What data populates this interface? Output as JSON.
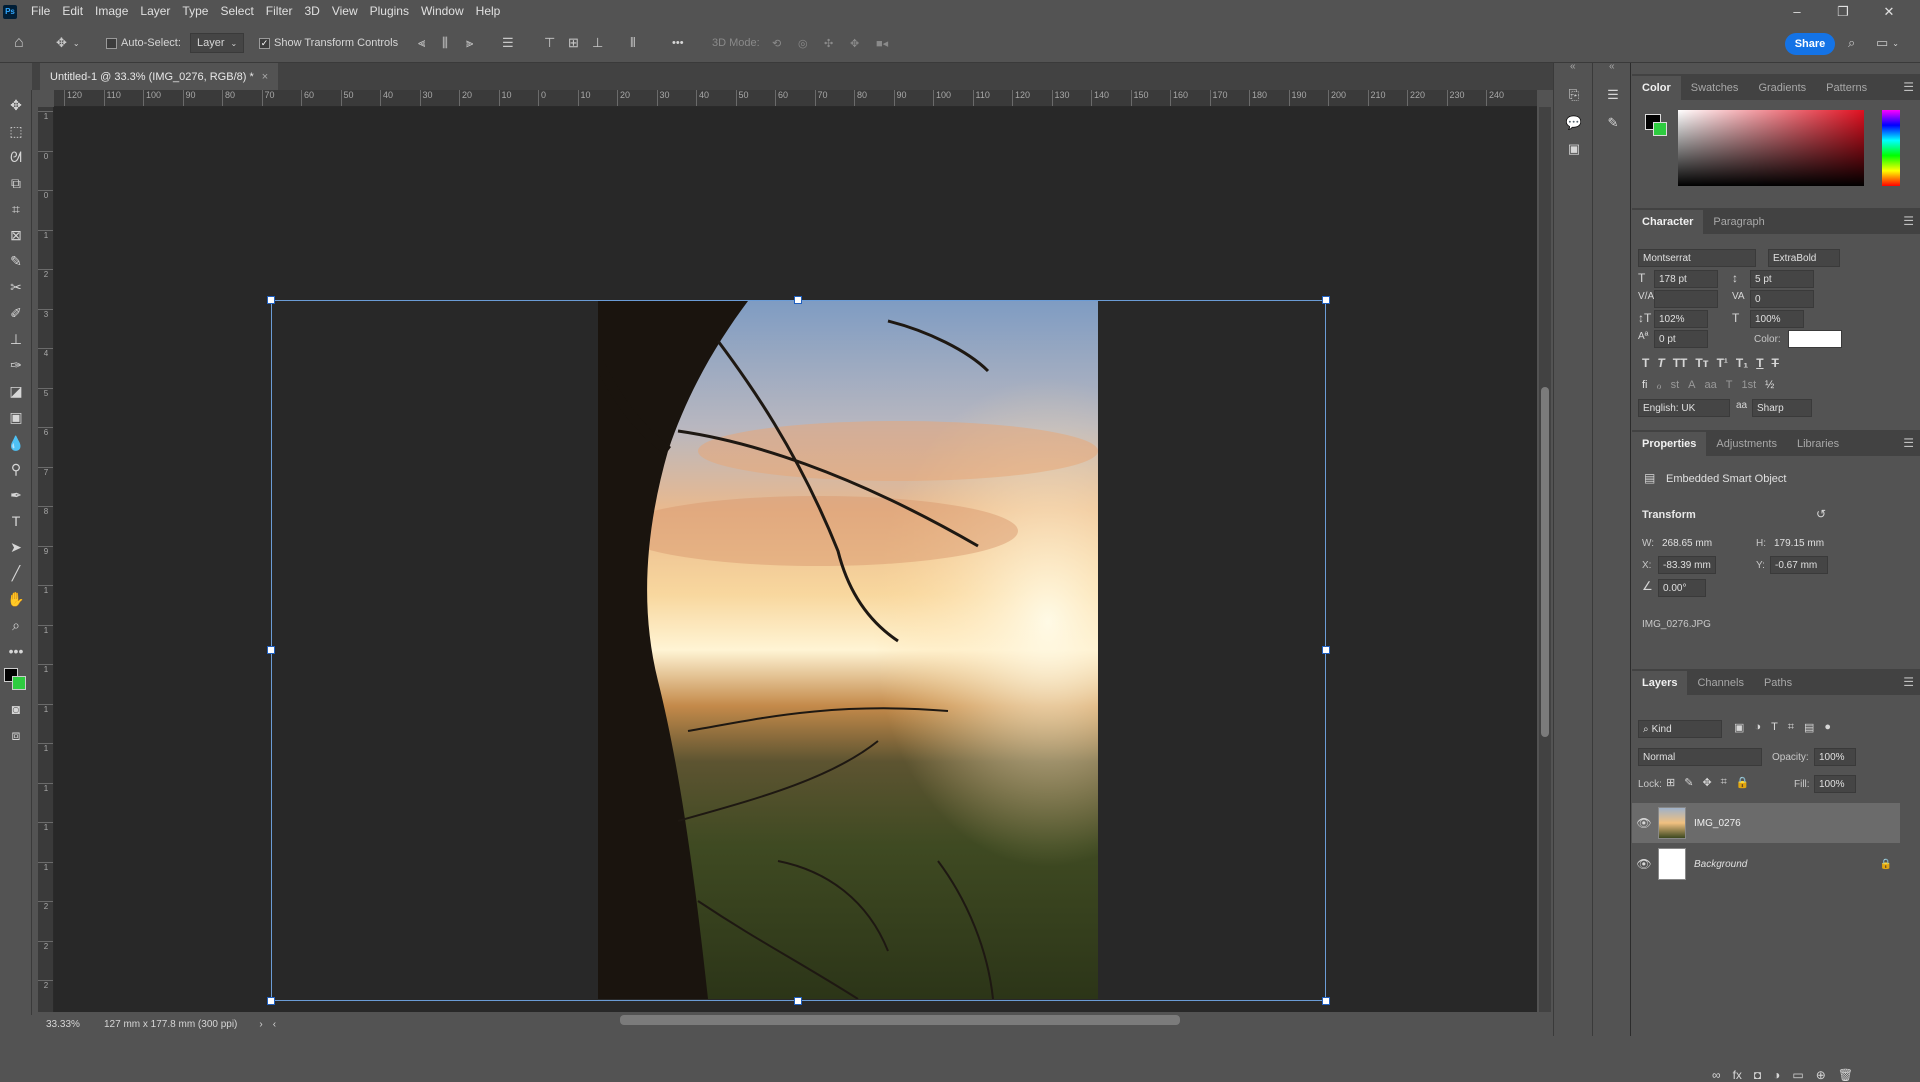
{
  "app": {
    "logo": "Ps",
    "menu": [
      "File",
      "Edit",
      "Image",
      "Layer",
      "Type",
      "Select",
      "Filter",
      "3D",
      "View",
      "Plugins",
      "Window",
      "Help"
    ],
    "window_buttons": [
      "–",
      "❐",
      "✕"
    ]
  },
  "options_bar": {
    "auto_select_label": "Auto-Select:",
    "auto_select_checked": false,
    "layer_dropdown": "Layer",
    "show_transform_label": "Show Transform Controls",
    "show_transform_checked": true,
    "more": "•••",
    "mode_3d_label": "3D Mode:",
    "share_label": "Share"
  },
  "document": {
    "tab_title": "Untitled-1 @ 33.3% (IMG_0276, RGB/8) *",
    "tab_close": "×",
    "zoom": "33.33%",
    "doc_info": "127 mm x 177.8 mm (300 ppi)",
    "ruler_top": [
      "120",
      "110",
      "100",
      "90",
      "80",
      "70",
      "60",
      "50",
      "40",
      "30",
      "20",
      "10",
      "0",
      "10",
      "20",
      "30",
      "40",
      "50",
      "60",
      "70",
      "80",
      "90",
      "100",
      "110",
      "120",
      "130",
      "140",
      "150",
      "160",
      "170",
      "180",
      "190",
      "200",
      "210",
      "220",
      "230",
      "240"
    ],
    "ruler_left": [
      "1",
      "0",
      "0",
      "1",
      "2",
      "3",
      "4",
      "5",
      "6",
      "7",
      "8",
      "9",
      "1",
      "1",
      "1",
      "1",
      "1",
      "1",
      "1",
      "1",
      "2",
      "2",
      "2"
    ]
  },
  "color_panel": {
    "tabs": [
      "Color",
      "Swatches",
      "Gradients",
      "Patterns"
    ],
    "active_tab": "Color",
    "foreground": "#000000",
    "background": "#2ecc40"
  },
  "character_panel": {
    "tabs": [
      "Character",
      "Paragraph"
    ],
    "font_family": "Montserrat",
    "font_style": "ExtraBold",
    "size": "178 pt",
    "leading": "5 pt",
    "kerning": "",
    "tracking": "0",
    "vertical_scale": "102%",
    "horizontal_scale": "100%",
    "baseline_shift": "0 pt",
    "color_label": "Color:",
    "style_buttons": [
      "T",
      "T",
      "TT",
      "Tт",
      "T¹",
      "T₁",
      "T",
      "T"
    ],
    "opentype_buttons": [
      "fi",
      "ℴ",
      "st",
      "A",
      "aa",
      "T",
      "1st",
      "½"
    ],
    "language": "English: UK",
    "aa_label": "aa",
    "antialias": "Sharp"
  },
  "properties_panel": {
    "tabs": [
      "Properties",
      "Adjustments",
      "Libraries"
    ],
    "object_type": "Embedded Smart Object",
    "transform_label": "Transform",
    "w_label": "W:",
    "w": "268.65 mm",
    "h_label": "H:",
    "h": "179.15 mm",
    "x_label": "X:",
    "x": "-83.39 mm",
    "y_label": "Y:",
    "y": "-0.67 mm",
    "angle": "0.00°",
    "file": "IMG_0276.JPG"
  },
  "layers_panel": {
    "tabs": [
      "Layers",
      "Channels",
      "Paths"
    ],
    "filter": "Kind",
    "blend_mode": "Normal",
    "opacity_label": "Opacity:",
    "opacity": "100%",
    "lock_label": "Lock:",
    "fill_label": "Fill:",
    "fill": "100%",
    "layers": [
      {
        "name": "IMG_0276",
        "selected": true,
        "locked": false
      },
      {
        "name": "Background",
        "selected": false,
        "locked": true
      }
    ],
    "footer_icons": [
      "link-icon",
      "fx-icon",
      "mask-icon",
      "adjustment-icon",
      "group-icon",
      "new-layer-icon",
      "trash-icon"
    ]
  }
}
